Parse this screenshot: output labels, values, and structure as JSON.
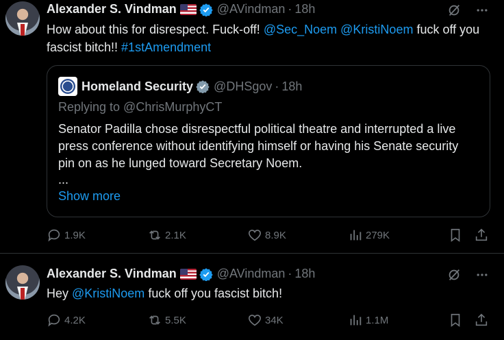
{
  "tweets": [
    {
      "author_name": "Alexander S. Vindman",
      "handle": "@AVindman",
      "dot": "·",
      "time": "18h",
      "text_before": "How about this for disrespect. Fuck-off! ",
      "mention1": "@Sec_Noem",
      "space1": " ",
      "mention2": "@KristiNoem",
      "text_after": " fuck off you fascist bitch!! ",
      "hashtag": "#1stAmendment",
      "quote": {
        "author_name": "Homeland Security",
        "handle": "@DHSgov",
        "dot": "·",
        "time": "18h",
        "replying": "Replying to @ChrisMurphyCT",
        "text": "Senator Padilla chose disrespectful political theatre and interrupted a live press conference without identifying himself or having his Senate security pin on as he lunged toward Secretary Noem.",
        "ellipsis": "...",
        "show_more": "Show more"
      },
      "replies": "1.9K",
      "reposts": "2.1K",
      "likes": "8.9K",
      "views": "279K"
    },
    {
      "author_name": "Alexander S. Vindman",
      "handle": "@AVindman",
      "dot": "·",
      "time": "18h",
      "text_before": "Hey ",
      "mention1": "@KristiNoem",
      "text_after": " fuck off you fascist bitch!",
      "replies": "4.2K",
      "reposts": "5.5K",
      "likes": "34K",
      "views": "1.1M"
    }
  ],
  "colors": {
    "accent": "#1d9bf0",
    "muted": "#71767b",
    "text": "#e7e9ea",
    "border": "#2f3336",
    "background": "#000000"
  }
}
